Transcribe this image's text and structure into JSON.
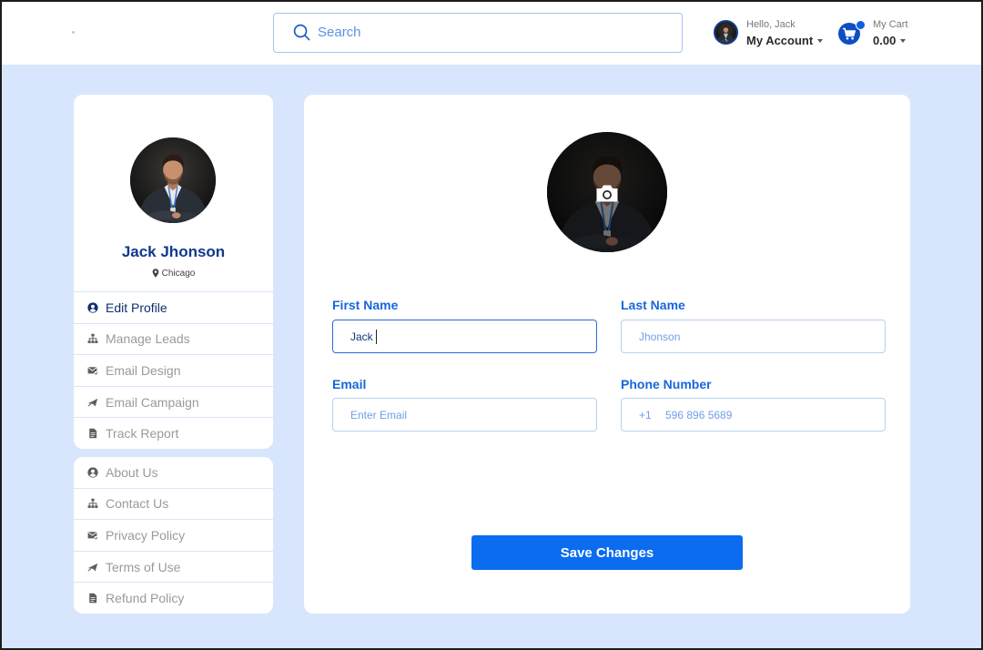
{
  "theme": {
    "accent": "#0b6cf0",
    "navy": "#0f3a8a",
    "background": "#d8e6fd",
    "label": "#1767d9",
    "placeholder": "#6f9fe6"
  },
  "header": {
    "search": {
      "placeholder": "Search"
    },
    "account": {
      "greeting": "Hello, Jack",
      "label": "My Account"
    },
    "cart": {
      "label": "My Cart",
      "amount": "0.00"
    }
  },
  "profile": {
    "name": "Jack Jhonson",
    "location": "Chicago"
  },
  "sidebar": {
    "menu": [
      {
        "label": "Edit Profile",
        "icon": "user-circle-icon",
        "active": true
      },
      {
        "label": "Manage Leads",
        "icon": "sitemap-icon"
      },
      {
        "label": "Email Design",
        "icon": "envelope-icon"
      },
      {
        "label": "Email Campaign",
        "icon": "send-icon"
      },
      {
        "label": "Track Report",
        "icon": "document-icon"
      }
    ],
    "links": [
      {
        "label": "About Us",
        "icon": "user-circle-icon"
      },
      {
        "label": "Contact Us",
        "icon": "sitemap-icon"
      },
      {
        "label": "Privacy Policy",
        "icon": "envelope-icon"
      },
      {
        "label": "Terms of Use",
        "icon": "send-icon"
      },
      {
        "label": "Refund Policy",
        "icon": "document-icon"
      }
    ]
  },
  "form": {
    "first_name": {
      "label": "First Name",
      "value": "Jack"
    },
    "last_name": {
      "label": "Last Name",
      "placeholder": "Jhonson"
    },
    "email": {
      "label": "Email",
      "placeholder": "Enter Email"
    },
    "phone": {
      "label": "Phone Number",
      "prefix": "+1",
      "placeholder": "596 896 5689"
    },
    "save_label": "Save Changes"
  }
}
